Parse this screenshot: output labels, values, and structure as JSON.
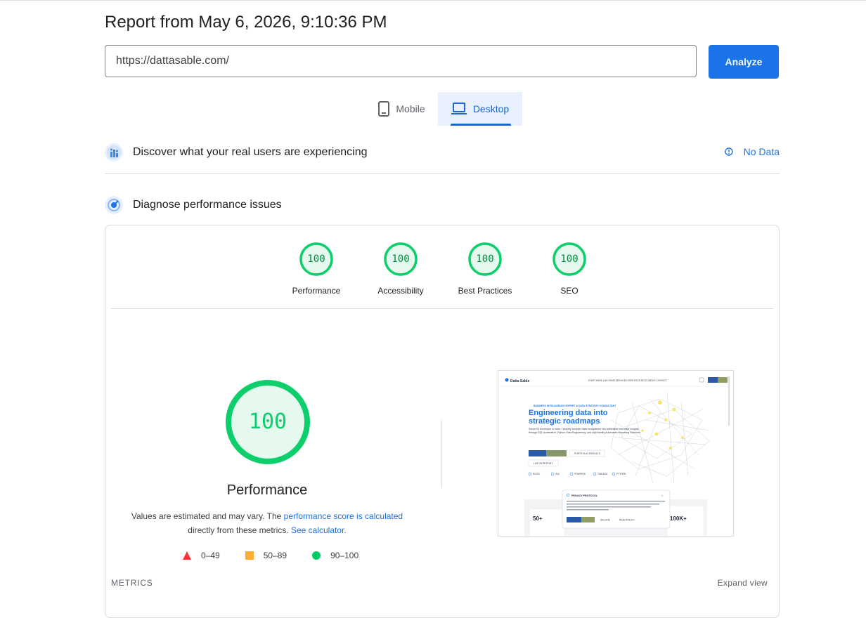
{
  "header": {
    "report_title": "Report from May 6, 2026, 9:10:36 PM",
    "url_value": "https://dattasable.com/",
    "analyze_label": "Analyze"
  },
  "device_tabs": {
    "mobile_label": "Mobile",
    "desktop_label": "Desktop",
    "selected": "Desktop"
  },
  "crux": {
    "title": "Discover what your real users are experiencing",
    "status": "No Data"
  },
  "diagnose": {
    "title": "Diagnose performance issues"
  },
  "scores": [
    {
      "label": "Performance",
      "value": "100"
    },
    {
      "label": "Accessibility",
      "value": "100"
    },
    {
      "label": "Best Practices",
      "value": "100"
    },
    {
      "label": "SEO",
      "value": "100"
    }
  ],
  "performance": {
    "score": "100",
    "label": "Performance",
    "disclaimer_prefix": "Values are estimated and may vary. The ",
    "score_link": "performance score is calculated",
    "disclaimer_middle": " directly from these metrics. ",
    "calculator_link": "See calculator."
  },
  "legend": [
    {
      "range": "0–49",
      "color": "#f33"
    },
    {
      "range": "50–89",
      "color": "#fa3"
    },
    {
      "range": "90–100",
      "color": "#0c6"
    }
  ],
  "metrics": {
    "label": "METRICS",
    "expand_label": "Expand view"
  },
  "screenshot": {
    "logo": "Datta Sable",
    "nav": "START HERE  LIVE DEMO  SERVICES  PORTFOLIO  BLOG  ABOUT  CONTACT",
    "kicker": "BUSINESS INTELLIGENCE EXPERT & DATA STRATEGY CONSULTANT",
    "headline_1": "Engineering data into",
    "headline_2": "strategic roadmaps",
    "subtitle": "Senior BI Developer in India. I simplify complex data ecosystems into actionable executive insights through SQL Automation, Python Data Engineering, and high-fidelity Automated Reporting Solutions.",
    "cta_secondary": "PORTFOLIO RESULTS",
    "cta_tertiary": "LIVE BI REPORT",
    "tools": [
      "EXCEL",
      "SQL",
      "POWER BI",
      "TABLEAU",
      "PYTHON"
    ],
    "stat_left": "50+",
    "stat_right": "100K+",
    "privacy_title": "PRIVACY PROTOCOL",
    "privacy_decline": "DECLINE",
    "privacy_more": "READ POLICY"
  },
  "colors": {
    "accent": "#1a73e8",
    "pass": "#0cce6b",
    "pass_bg": "#e6f9ee"
  }
}
